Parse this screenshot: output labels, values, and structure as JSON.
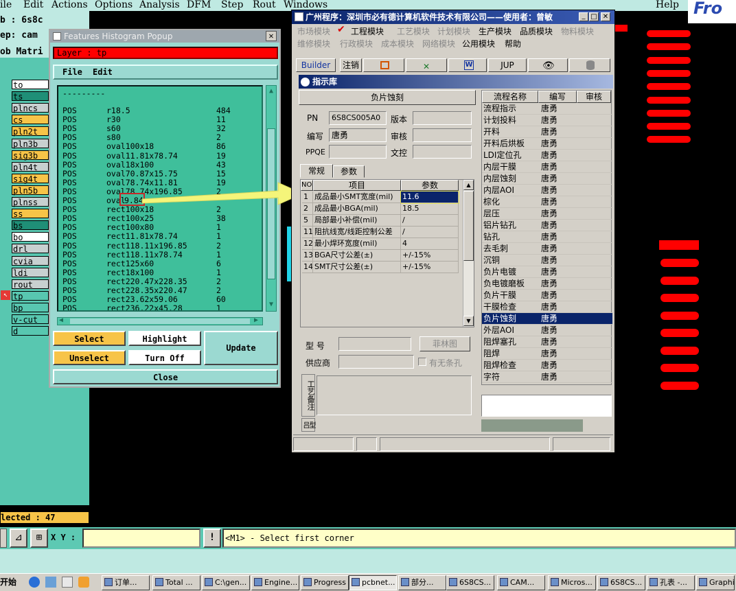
{
  "menubar": {
    "items": [
      "ile",
      "Edit",
      "Actions",
      "Options",
      "Analysis",
      "DFM",
      "Step",
      "Rout",
      "Windows"
    ],
    "help": "Help",
    "logo": "Fro"
  },
  "left_panel": {
    "job_line": "b : 6s8c",
    "step_line": "ep: cam",
    "matrix_label": "ob Matri",
    "layers": [
      {
        "name": "to",
        "color": "#ffffff"
      },
      {
        "name": "ts",
        "color": "#1f8f77"
      },
      {
        "name": "plncs",
        "color": "#c8d0d0"
      },
      {
        "name": "cs",
        "color": "#f7c448"
      },
      {
        "name": "pln2t",
        "color": "#f7c448"
      },
      {
        "name": "pln3b",
        "color": "#c8d0d0"
      },
      {
        "name": "sig3b",
        "color": "#f7c448"
      },
      {
        "name": "pln4t",
        "color": "#c8d0d0"
      },
      {
        "name": "sig4t",
        "color": "#f7c448"
      },
      {
        "name": "pln5b",
        "color": "#f7c448"
      },
      {
        "name": "plnss",
        "color": "#c8d0d0"
      },
      {
        "name": "ss",
        "color": "#f7c448"
      },
      {
        "name": "bs",
        "color": "#1f8f77"
      },
      {
        "name": "bo",
        "color": "#ffffff"
      },
      {
        "name": "drl",
        "color": "#c8d0d0"
      },
      {
        "name": "cvia",
        "color": "#c8d0d0"
      },
      {
        "name": "ldi",
        "color": "#c8d0d0"
      },
      {
        "name": "rout",
        "color": "#c8d0d0"
      },
      {
        "name": "tp",
        "color": "#58c7b0"
      },
      {
        "name": "bp",
        "color": "#58c7b0"
      },
      {
        "name": "v-cut",
        "color": "#58c7b0"
      },
      {
        "name": "d",
        "color": "#58c7b0"
      }
    ],
    "selected": "lected : 47"
  },
  "features_popup": {
    "title": "Features Histogram Popup",
    "layer_label": "Layer :  tp",
    "menu": [
      "File",
      "Edit"
    ],
    "separator": "---------",
    "rows": [
      [
        "POS",
        "r18.5",
        "484"
      ],
      [
        "POS",
        "r30",
        "11"
      ],
      [
        "POS",
        "s60",
        "32"
      ],
      [
        "POS",
        "s80",
        "2"
      ],
      [
        "POS",
        "oval100x18",
        "86"
      ],
      [
        "POS",
        "oval11.81x78.74",
        "19"
      ],
      [
        "POS",
        "oval18x100",
        "43"
      ],
      [
        "POS",
        "oval70.87x15.75",
        "15"
      ],
      [
        "POS",
        "oval78.74x11.81",
        "19"
      ],
      [
        "POS",
        "oval78.74x196.85",
        "2"
      ],
      [
        "POS",
        "oval",
        "9.84"
      ],
      [
        "POS",
        "rect100x18",
        "2"
      ],
      [
        "POS",
        "rect100x25",
        "38"
      ],
      [
        "POS",
        "rect100x80",
        "1"
      ],
      [
        "POS",
        "rect11.81x78.74",
        "1"
      ],
      [
        "POS",
        "rect118.11x196.85",
        "2"
      ],
      [
        "POS",
        "rect118.11x78.74",
        "1"
      ],
      [
        "POS",
        "rect125x60",
        "6"
      ],
      [
        "POS",
        "rect18x100",
        "1"
      ],
      [
        "POS",
        "rect220.47x228.35",
        "2"
      ],
      [
        "POS",
        "rect228.35x220.47",
        "2"
      ],
      [
        "POS",
        "rect23.62x59.06",
        "60"
      ],
      [
        "POS",
        "rect236.22x45.28",
        "1"
      ]
    ],
    "buttons": {
      "select": "Select",
      "highlight": "Highlight",
      "update": "Update",
      "unselect": "Unselect",
      "turn_off": "Turn Off",
      "close": "Close"
    }
  },
  "cwin": {
    "title": "广州程序：深圳市必有德计算机软件技术有限公司——使用者：曾敏",
    "menu_row1": [
      "市场模块",
      "工程模块",
      "工艺模块",
      "计划模块",
      "生产模块",
      "品质模块",
      "物料模块"
    ],
    "menu_row2": [
      "维修模块",
      "行政模块",
      "成本模块",
      "网络模块",
      "公用模块",
      "帮助"
    ],
    "toolbar": [
      "Builder",
      "注销",
      "",
      "",
      "",
      "JUP",
      "",
      ""
    ],
    "section_title": "指示库",
    "form_header": "负片蚀刻",
    "pn_label": "PN",
    "pn_value": "6S8CS005A0",
    "version_label": "版本",
    "author_label": "编写",
    "author_value": "唐勇",
    "review_label": "审核",
    "ppqe_label": "PPQE",
    "text_label": "文控",
    "tabs": [
      "常规",
      "参数"
    ],
    "param_headers": [
      "NO",
      "项目",
      "参数"
    ],
    "params": [
      [
        "1",
        "成品最小SMT宽度(mil)",
        "11.6"
      ],
      [
        "2",
        "成品最小BGA(mil)",
        "18.5"
      ],
      [
        "5",
        "局部最小补偿(mil)",
        "/"
      ],
      [
        "11",
        "阻抗线宽/线距控制公差",
        "/"
      ],
      [
        "12",
        "最小焊环宽度(mil)",
        "4"
      ],
      [
        "13",
        "BGA尺寸公差(±)",
        "+/-15%"
      ],
      [
        "14",
        "SMT尺寸公差(±)",
        "+/-15%"
      ]
    ],
    "model_label": "型  号",
    "lin_button": "菲林图",
    "supplier_label": "供应商",
    "has_nobar": "有无条孔",
    "remark_label": "工艺备注",
    "remark2": "型吕",
    "flow_headers": [
      "流程名称",
      "编写",
      "审核"
    ],
    "flows": [
      [
        "流程指示",
        "唐勇"
      ],
      [
        "计划投料",
        "唐勇"
      ],
      [
        "开料",
        "唐勇"
      ],
      [
        "开料后烘板",
        "唐勇"
      ],
      [
        "LDI定位孔",
        "唐勇"
      ],
      [
        "内层干膜",
        "唐勇"
      ],
      [
        "内层蚀刻",
        "唐勇"
      ],
      [
        "内层AOI",
        "唐勇"
      ],
      [
        "棕化",
        "唐勇"
      ],
      [
        "层压",
        "唐勇"
      ],
      [
        "铝片钻孔",
        "唐勇"
      ],
      [
        "钻孔",
        "唐勇"
      ],
      [
        "去毛刺",
        "唐勇"
      ],
      [
        "沉铜",
        "唐勇"
      ],
      [
        "负片电镀",
        "唐勇"
      ],
      [
        "负电镀磨板",
        "唐勇"
      ],
      [
        "负片干膜",
        "唐勇"
      ],
      [
        "干膜检查",
        "唐勇"
      ],
      [
        "负片蚀刻",
        "唐勇"
      ],
      [
        "外层AOI",
        "唐勇"
      ],
      [
        "阻焊塞孔",
        "唐勇"
      ],
      [
        "阻焊",
        "唐勇"
      ],
      [
        "阻焊检查",
        "唐勇"
      ],
      [
        "字符",
        "唐勇"
      ]
    ]
  },
  "cmdbar": {
    "xy_label": "X Y :",
    "status": "<M1> - Select first corner"
  },
  "taskbar": {
    "start": "开始",
    "tasks": [
      "订单...",
      "Total ...",
      "C:\\gen...",
      "Engine...",
      "Progress",
      "pcbnet...",
      "部分...",
      "6S8CS...",
      "CAM...",
      "Micros...",
      "6S8CS...",
      "孔表 -...",
      "Graphi..."
    ]
  }
}
